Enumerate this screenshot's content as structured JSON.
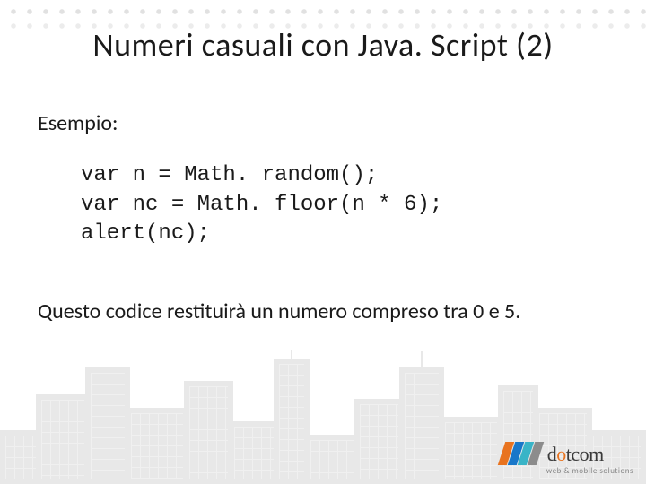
{
  "title": "Numeri casuali con Java. Script (2)",
  "subhead": "Esempio:",
  "code": {
    "line1": "var n = Math. random();",
    "line2": "var nc = Math. floor(n * 6);",
    "line3": "alert(nc);"
  },
  "explain": "Questo codice restituirà un numero compreso tra 0 e 5.",
  "logo": {
    "name_prefix": "d",
    "name_dot": "o",
    "name_suffix": "tcom",
    "tagline": "web & mobile solutions"
  }
}
